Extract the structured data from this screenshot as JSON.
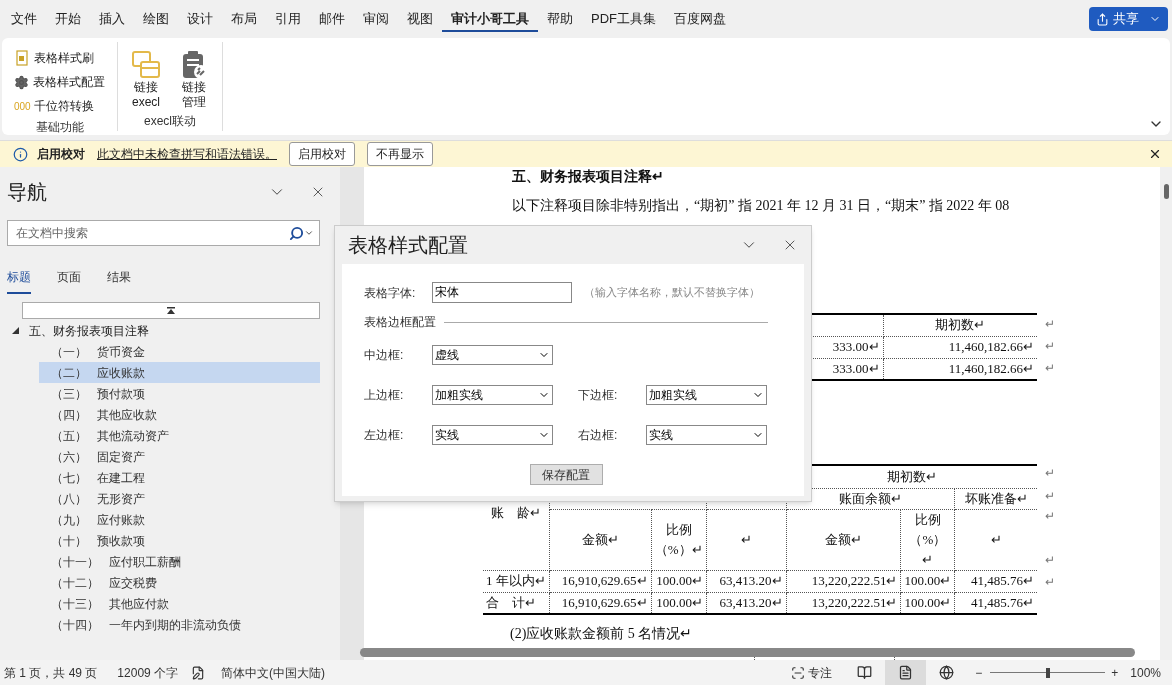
{
  "ribbon_tabs": [
    {
      "label": "文件",
      "selected": false
    },
    {
      "label": "开始",
      "selected": false
    },
    {
      "label": "插入",
      "selected": false
    },
    {
      "label": "绘图",
      "selected": false
    },
    {
      "label": "设计",
      "selected": false
    },
    {
      "label": "布局",
      "selected": false
    },
    {
      "label": "引用",
      "selected": false
    },
    {
      "label": "邮件",
      "selected": false
    },
    {
      "label": "审阅",
      "selected": false
    },
    {
      "label": "视图",
      "selected": false
    },
    {
      "label": "审计小哥工具",
      "selected": true
    },
    {
      "label": "帮助",
      "selected": false
    },
    {
      "label": "PDF工具集",
      "selected": false
    },
    {
      "label": "百度网盘",
      "selected": false
    }
  ],
  "share_button": {
    "label": "共享"
  },
  "ribbon_groups": [
    {
      "label": "基础功能",
      "items": [
        {
          "kind": "small",
          "label": "表格样式刷"
        },
        {
          "kind": "small",
          "label": "表格样式配置"
        },
        {
          "kind": "small",
          "glyph": "000",
          "label": "千位符转换"
        }
      ]
    },
    {
      "label": "execl联动",
      "items": [
        {
          "kind": "large",
          "lines": [
            "链接",
            "execl"
          ]
        },
        {
          "kind": "large",
          "lines": [
            "链接",
            "管理"
          ]
        }
      ]
    }
  ],
  "info_bar": {
    "title": "启用校对",
    "message": "此文档中未检查拼写和语法错误。",
    "buttons": [
      "启用校对",
      "不再显示"
    ]
  },
  "nav": {
    "title": "导航",
    "search": {
      "placeholder": "在文档中搜索"
    },
    "tabs": [
      {
        "label": "标题",
        "selected": true
      },
      {
        "label": "页面",
        "selected": false
      },
      {
        "label": "结果",
        "selected": false
      }
    ],
    "tree": [
      {
        "label": "五、财务报表项目注释",
        "expanded": true,
        "selected": false,
        "children": [
          {
            "number": "（一）",
            "label": "货币资金",
            "selected": false
          },
          {
            "number": "（二）",
            "label": "应收账款",
            "selected": true
          },
          {
            "number": "（三）",
            "label": "预付款项",
            "selected": false
          },
          {
            "number": "（四）",
            "label": "其他应收款",
            "selected": false
          },
          {
            "number": "（五）",
            "label": "其他流动资产",
            "selected": false
          },
          {
            "number": "（六）",
            "label": "固定资产",
            "selected": false
          },
          {
            "number": "（七）",
            "label": "在建工程",
            "selected": false
          },
          {
            "number": "（八）",
            "label": "无形资产",
            "selected": false
          },
          {
            "number": "（九）",
            "label": "应付账款",
            "selected": false
          },
          {
            "number": "（十）",
            "label": "预收款项",
            "selected": false
          },
          {
            "number": "（十一）",
            "label": "应付职工薪酬",
            "selected": false
          },
          {
            "number": "（十二）",
            "label": "应交税费",
            "selected": false
          },
          {
            "number": "（十三）",
            "label": "其他应付款",
            "selected": false
          },
          {
            "number": "（十四）",
            "label": "一年内到期的非流动负债",
            "selected": false
          }
        ]
      }
    ]
  },
  "document": {
    "heading": "五、财务报表项目注释↵",
    "paragraph": "以下注释项目除非特别指出，“期初” 指 2021 年 12 月 31 日，“期末” 指 2022 年 08",
    "table_1": {
      "header": "期初数↵",
      "rows": [
        [
          "333.00↵",
          "11,460,182.66↵"
        ],
        [
          "333.00↵",
          "11,460,182.66↵"
        ]
      ],
      "end_mark": "↵"
    },
    "table_2": {
      "period": "期初数↵",
      "group": [
        "账面余额↵",
        "坏账准备↵"
      ],
      "age": "账　龄↵",
      "sub": [
        "金额↵",
        "比例（%）↵",
        "↵",
        "金额↵",
        "比例（%）↵",
        "↵"
      ],
      "rows": [
        [
          "1 年以内↵",
          "16,910,629.65↵",
          "100.00↵",
          "63,413.20↵",
          "13,220,222.51↵",
          "100.00↵",
          "41,485.76↵"
        ],
        [
          "合　计↵",
          "16,910,629.65↵",
          "100.00↵",
          "63,413.20↵",
          "13,220,222.51↵",
          "100.00↵",
          "41,485.76↵"
        ]
      ],
      "end_mark": "↵"
    },
    "caption": "(2)应收账款金额前 5 名情况↵"
  },
  "dialog": {
    "title": "表格样式配置",
    "font_field": {
      "label": "表格字体:",
      "value": "宋体",
      "hint": "（输入字体名称，默认不替换字体）"
    },
    "section": "表格边框配置",
    "rows": [
      [
        {
          "label": "中边框:",
          "value": "虚线"
        }
      ],
      [
        {
          "label": "上边框:",
          "value": "加粗实线"
        },
        {
          "label": "下边框:",
          "value": "加粗实线"
        }
      ],
      [
        {
          "label": "左边框:",
          "value": "实线"
        },
        {
          "label": "右边框:",
          "value": "实线"
        }
      ]
    ],
    "save_button": "保存配置"
  },
  "status_bar": {
    "page": "第 1 页，共 49 页",
    "words": "12009 个字",
    "language": "简体中文(中国大陆)",
    "focus": "专注",
    "views": [
      {
        "kind": "read",
        "selected": false
      },
      {
        "kind": "print",
        "selected": true
      },
      {
        "kind": "web",
        "selected": false
      }
    ],
    "zoom": {
      "minus": "−",
      "plus": "+",
      "level": 0.5,
      "reading": "100%"
    }
  }
}
